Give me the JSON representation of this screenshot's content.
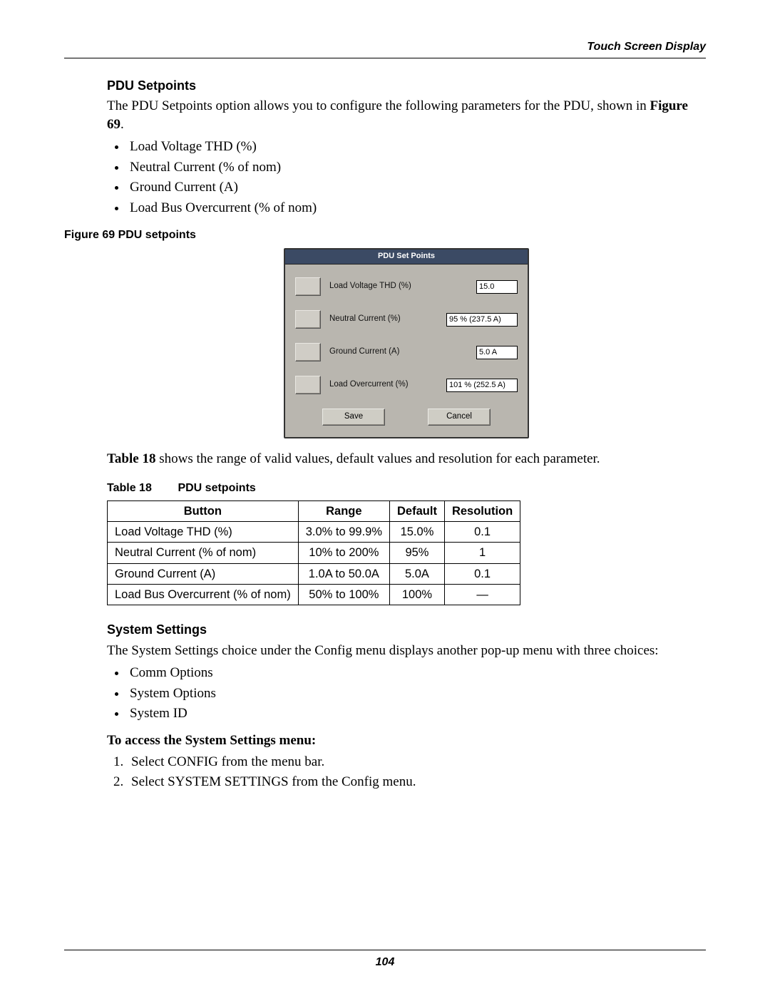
{
  "header": {
    "running": "Touch Screen Display"
  },
  "section1": {
    "title": "PDU Setpoints",
    "intro_a": "The PDU Setpoints option allows you to configure the following parameters for the PDU, shown in ",
    "intro_b": "Figure 69",
    "intro_c": ".",
    "bullets": [
      "Load Voltage THD (%)",
      "Neutral Current (% of nom)",
      "Ground Current (A)",
      "Load Bus Overcurrent (% of nom)"
    ],
    "fig_caption": "Figure 69  PDU setpoints"
  },
  "screenshot": {
    "title": "PDU Set Points",
    "rows": [
      {
        "label": "Load Voltage THD (%)",
        "value": "15.0"
      },
      {
        "label": "Neutral Current (%)",
        "value": "95 % (237.5 A)"
      },
      {
        "label": "Ground Current (A)",
        "value": "5.0 A"
      },
      {
        "label": "Load Overcurrent (%)",
        "value": "101 % (252.5 A)"
      }
    ],
    "save": "Save",
    "cancel": "Cancel"
  },
  "aftershot": {
    "pre": "Table 18",
    "post": " shows the range of valid values, default values and resolution for each parameter."
  },
  "table18": {
    "caption_num": "Table 18",
    "caption_txt": "PDU setpoints",
    "headers": [
      "Button",
      "Range",
      "Default",
      "Resolution"
    ],
    "rows": [
      [
        "Load Voltage THD (%)",
        "3.0% to 99.9%",
        "15.0%",
        "0.1"
      ],
      [
        "Neutral Current (% of nom)",
        "10% to 200%",
        "95%",
        "1"
      ],
      [
        "Ground Current (A)",
        "1.0A to 50.0A",
        "5.0A",
        "0.1"
      ],
      [
        "Load Bus Overcurrent (% of nom)",
        "50% to 100%",
        "100%",
        "—"
      ]
    ]
  },
  "section2": {
    "title": "System Settings",
    "intro": "The System Settings choice under the Config menu displays another pop-up menu with three choices:",
    "bullets": [
      "Comm Options",
      "System Options",
      "System ID"
    ],
    "subhead": "To access the System Settings menu:",
    "steps": [
      "Select CONFIG from the menu bar.",
      "Select SYSTEM SETTINGS from the Config menu."
    ]
  },
  "page_number": "104"
}
